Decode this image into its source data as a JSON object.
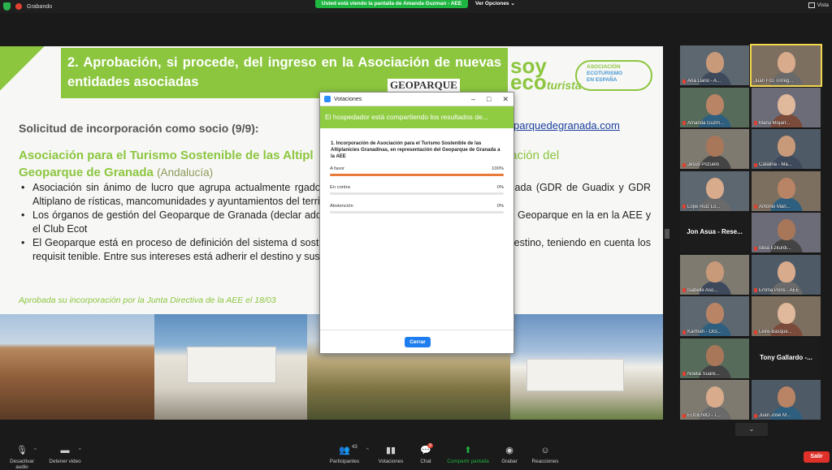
{
  "topbar": {
    "recording_label": "Grabando",
    "share_banner": "Usted está viendo la pantalla de Amanda Guzman - AEE",
    "view_options": "Ver Opciones",
    "view_label": "Vista"
  },
  "slide": {
    "title": "2. Aprobación, si procede, del ingreso en la Asociación de nuevas entidades asociadas",
    "geoparque_logo": "GEOPARQUE",
    "soyeco_line1": "soy",
    "soyeco_line2": "eco",
    "soyeco_line3": "turista",
    "badge_line1": "ASOCIACIÓN",
    "badge_line2": "ECOTURISMO",
    "badge_line3": "EN ESPAÑA",
    "link": "parquedegranada.com",
    "request": "Solicitud de incorporación como socio (9/9):",
    "association_a": "Asociación para el Turismo Sostenible de las Altipl",
    "association_b": "tación del",
    "association_c": "Geoparque de Granada",
    "association_region": "(Andalucía)",
    "bullets": [
      "Asociación sin ánimo de lucro que agrupa actualmente                                                     rgados de la dirección del Geoparque de Granada (GDR de Guadix y GDR Altiplano de                                               rísticas, mancomunidades y ayuntamientos  del territorio.",
      "Los órganos de gestión del Geoparque de Granada (declar                                                   ado que sea esta entidad la que represente al Geoparque en la  en la AEE y el Club Ecot",
      "El Geoparque está en proceso de definición del sistema d                                                   sostenibilidad turística para las empresas del destino, teniendo en cuenta los requisit                                          tenible. Entre sus intereses está adherir el destino y sus empresas certificadas al Club E"
    ],
    "approved_note": "Aprobada su incorporación por la Junta Directiva de la AEE el 18/03"
  },
  "poll_dialog": {
    "window_title": "Votaciones",
    "banner": "El hospedador está compartiendo los resultados de...",
    "question": "1. Incorporación de Asociación para el Turismo Sostenible de las Altiplanicies Granadinas, en representación del Geoparque de Granada a la AEE",
    "options": [
      {
        "label": "A favor",
        "percent_text": "100%",
        "percent": 100
      },
      {
        "label": "En contra",
        "percent_text": "0%",
        "percent": 0
      },
      {
        "label": "Abstención",
        "percent_text": "0%",
        "percent": 0
      }
    ],
    "close_button": "Cerrar"
  },
  "participants": [
    {
      "name": "Ana Llano - A...",
      "muted": true
    },
    {
      "name": "Juan Fco Torreg...",
      "muted": false
    },
    {
      "name": "Amanda Guzm...",
      "muted": true
    },
    {
      "name": "Manu Mojarr...",
      "muted": true
    },
    {
      "name": "Jesús Pozuelo",
      "muted": true
    },
    {
      "name": "Catalina - Ma...",
      "muted": true
    },
    {
      "name": "Lope Ruiz Lo...",
      "muted": true
    },
    {
      "name": "Antonio Man...",
      "muted": true
    },
    {
      "name": "Jon Asua - Rese...",
      "muted": false,
      "name_card": true
    },
    {
      "name": "Idoia Ezkurdi...",
      "muted": true
    },
    {
      "name": "Isabelle Aso...",
      "muted": true
    },
    {
      "name": "Emma Pons - AEE",
      "muted": true
    },
    {
      "name": "Karmah - Ocs...",
      "muted": true
    },
    {
      "name": "Leire-Basque...",
      "muted": true
    },
    {
      "name": "Noelia Suare...",
      "muted": true
    },
    {
      "name": "Tony Gallardo -...",
      "muted": false,
      "name_card": true
    },
    {
      "name": "EUGENIO - T...",
      "muted": true
    },
    {
      "name": "Juan José M...",
      "muted": true
    }
  ],
  "toolbar": {
    "mute_label": "Desactivar audio",
    "video_label": "Detener video",
    "participants_label": "Participantes",
    "participants_count": "43",
    "polls_label": "Votaciones",
    "chat_label": "Chat",
    "chat_badge": "9",
    "share_label": "Compartir pantalla",
    "record_label": "Grabar",
    "reactions_label": "Reacciones",
    "leave_label": "Salir"
  },
  "colors": {
    "slide_green": "#8cc63f",
    "share_green": "#1fb541",
    "poll_bar": "#e87a3b",
    "leave_red": "#e0302a",
    "zoom_blue": "#1e7ef0"
  }
}
